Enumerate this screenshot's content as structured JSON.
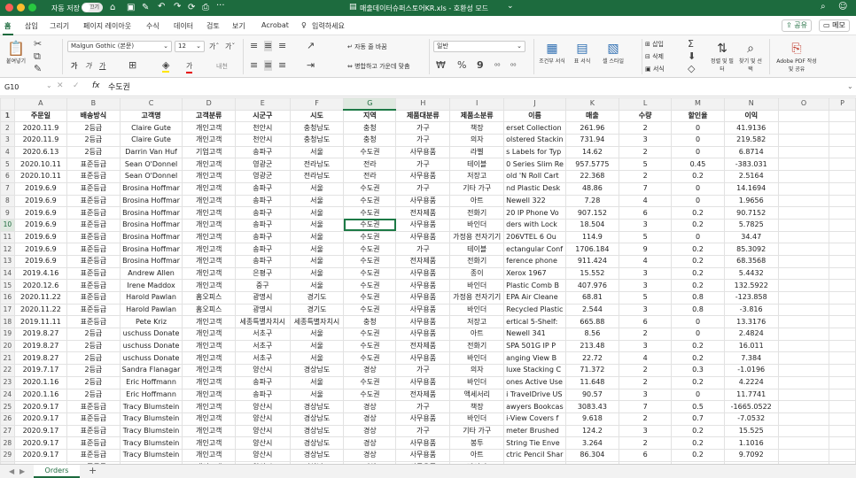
{
  "titlebar": {
    "autosave_label": "자동 저장",
    "autosave_toggle": "끄기",
    "file_title": "매출데이터슈퍼스토어KR.xls  -  호환성 모드",
    "chev": "⌄"
  },
  "tabs": [
    "홈",
    "삽입",
    "그리기",
    "페이지 레이아웃",
    "수식",
    "데이터",
    "검토",
    "보기",
    "Acrobat"
  ],
  "tell_me": "입력하세요",
  "share_label": "공유",
  "memo_label": "메모",
  "ribbon": {
    "paste": "붙여넣기",
    "font_name": "Malgun Gothic (본문)",
    "font_size": "12",
    "grow": "가ˆ",
    "shrink": "가ˇ",
    "bold": "가",
    "italic": "가",
    "underline": "가",
    "font_color_label": "가",
    "wrap": "자동 줄 바꿈",
    "merge": "병합하고 가운데 맞춤",
    "number_format": "일반",
    "percent": "%",
    "comma": "9",
    "cond_format": "조건부 서식",
    "table_format": "표 서식",
    "cell_style": "셀 스타일",
    "insert": "삽입",
    "delete": "삭제",
    "format": "서식",
    "sort_filter": "정렬 및 필터",
    "find_select": "찾기 및 선택",
    "adobe": "Adobe PDF 작성 및 공유"
  },
  "formula_bar": {
    "name_box": "G10",
    "fx": "fx",
    "value": "수도권"
  },
  "columns": [
    "A",
    "B",
    "C",
    "D",
    "E",
    "F",
    "G",
    "H",
    "I",
    "J",
    "K",
    "L",
    "M",
    "N",
    "O",
    "P"
  ],
  "rows": [
    [
      "주문일",
      "배송방식",
      "고객명",
      "고객분류",
      "시군구",
      "시도",
      "지역",
      "제품대분류",
      "제품소분류",
      "이름",
      "매출",
      "수량",
      "할인율",
      "이익",
      "",
      ""
    ],
    [
      "2020.11.9",
      "2등급",
      "Claire Gute",
      "개인고객",
      "천안시",
      "충청남도",
      "충청",
      "가구",
      "책장",
      "erset Collection",
      "261.96",
      "2",
      "0",
      "41.9136",
      "",
      ""
    ],
    [
      "2020.11.9",
      "2등급",
      "Claire Gute",
      "개인고객",
      "천안시",
      "충청남도",
      "충청",
      "가구",
      "의자",
      "olstered Stackin",
      "731.94",
      "3",
      "0",
      "219.582",
      "",
      ""
    ],
    [
      "2020.6.13",
      "2등급",
      "Darrin Van Huf",
      "기업고객",
      "송파구",
      "서울",
      "수도권",
      "사무용품",
      "라벨",
      "s Labels for Typ",
      "14.62",
      "2",
      "0",
      "6.8714",
      "",
      ""
    ],
    [
      "2020.10.11",
      "표준등급",
      "Sean O'Donnel",
      "개인고객",
      "영광군",
      "전라남도",
      "전라",
      "가구",
      "테이블",
      "0 Series Slim Re",
      "957.5775",
      "5",
      "0.45",
      "-383.031",
      "",
      ""
    ],
    [
      "2020.10.11",
      "표준등급",
      "Sean O'Donnel",
      "개인고객",
      "영광군",
      "전라남도",
      "전라",
      "사무용품",
      "저장고",
      "old 'N Roll Cart",
      "22.368",
      "2",
      "0.2",
      "2.5164",
      "",
      ""
    ],
    [
      "2019.6.9",
      "표준등급",
      "Brosina Hoffmar",
      "개인고객",
      "송파구",
      "서울",
      "수도권",
      "가구",
      "기타 가구",
      "nd Plastic Desk",
      "48.86",
      "7",
      "0",
      "14.1694",
      "",
      ""
    ],
    [
      "2019.6.9",
      "표준등급",
      "Brosina Hoffmar",
      "개인고객",
      "송파구",
      "서울",
      "수도권",
      "사무용품",
      "아트",
      "Newell 322",
      "7.28",
      "4",
      "0",
      "1.9656",
      "",
      ""
    ],
    [
      "2019.6.9",
      "표준등급",
      "Brosina Hoffmar",
      "개인고객",
      "송파구",
      "서울",
      "수도권",
      "전자제품",
      "전화기",
      "20 IP Phone Vo",
      "907.152",
      "6",
      "0.2",
      "90.7152",
      "",
      ""
    ],
    [
      "2019.6.9",
      "표준등급",
      "Brosina Hoffmar",
      "개인고객",
      "송파구",
      "서울",
      "수도권",
      "사무용품",
      "바인더",
      "ders with Lock",
      "18.504",
      "3",
      "0.2",
      "5.7825",
      "",
      ""
    ],
    [
      "2019.6.9",
      "표준등급",
      "Brosina Hoffmar",
      "개인고객",
      "송파구",
      "서울",
      "수도권",
      "사무용품",
      "가정용 전자기기",
      "206VTEL 6 Ou",
      "114.9",
      "5",
      "0",
      "34.47",
      "",
      ""
    ],
    [
      "2019.6.9",
      "표준등급",
      "Brosina Hoffmar",
      "개인고객",
      "송파구",
      "서울",
      "수도권",
      "가구",
      "테이블",
      "ectangular Conf",
      "1706.184",
      "9",
      "0.2",
      "85.3092",
      "",
      ""
    ],
    [
      "2019.6.9",
      "표준등급",
      "Brosina Hoffmar",
      "개인고객",
      "송파구",
      "서울",
      "수도권",
      "전자제품",
      "전화기",
      "ference phone",
      "911.424",
      "4",
      "0.2",
      "68.3568",
      "",
      ""
    ],
    [
      "2019.4.16",
      "표준등급",
      "Andrew Allen",
      "개인고객",
      "은평구",
      "서울",
      "수도권",
      "사무용품",
      "종이",
      "Xerox 1967",
      "15.552",
      "3",
      "0.2",
      "5.4432",
      "",
      ""
    ],
    [
      "2020.12.6",
      "표준등급",
      "Irene Maddox",
      "개인고객",
      "중구",
      "서울",
      "수도권",
      "사무용품",
      "바인더",
      "Plastic Comb B",
      "407.976",
      "3",
      "0.2",
      "132.5922",
      "",
      ""
    ],
    [
      "2020.11.22",
      "표준등급",
      "Harold Pawlan",
      "홈오피스",
      "광명시",
      "경기도",
      "수도권",
      "사무용품",
      "가정용 전자기기",
      "EPA Air Cleane",
      "68.81",
      "5",
      "0.8",
      "-123.858",
      "",
      ""
    ],
    [
      "2020.11.22",
      "표준등급",
      "Harold Pawlan",
      "홈오피스",
      "광명시",
      "경기도",
      "수도권",
      "사무용품",
      "바인더",
      "Recycled Plastic",
      "2.544",
      "3",
      "0.8",
      "-3.816",
      "",
      ""
    ],
    [
      "2019.11.11",
      "표준등급",
      "Pete Kriz",
      "개인고객",
      "세종특별자치시",
      "세종특별자치시",
      "충청",
      "사무용품",
      "저장고",
      "ertical 5-Shelf: ",
      "665.88",
      "6",
      "0",
      "13.3176",
      "",
      ""
    ],
    [
      "2019.8.27",
      "2등급",
      "uschuss Donate",
      "개인고객",
      "서초구",
      "서울",
      "수도권",
      "사무용품",
      "아트",
      "Newell 341",
      "8.56",
      "2",
      "0",
      "2.4824",
      "",
      ""
    ],
    [
      "2019.8.27",
      "2등급",
      "uschuss Donate",
      "개인고객",
      "서초구",
      "서울",
      "수도권",
      "전자제품",
      "전화기",
      "SPA 501G IP P",
      "213.48",
      "3",
      "0.2",
      "16.011",
      "",
      ""
    ],
    [
      "2019.8.27",
      "2등급",
      "uschuss Donate",
      "개인고객",
      "서초구",
      "서울",
      "수도권",
      "사무용품",
      "바인더",
      "anging View B",
      "22.72",
      "4",
      "0.2",
      "7.384",
      "",
      ""
    ],
    [
      "2019.7.17",
      "2등급",
      "Sandra Flanagar",
      "개인고객",
      "양산시",
      "경상남도",
      "경상",
      "가구",
      "의자",
      "luxe Stacking C",
      "71.372",
      "2",
      "0.3",
      "-1.0196",
      "",
      ""
    ],
    [
      "2020.1.16",
      "2등급",
      "Eric Hoffmann",
      "개인고객",
      "송파구",
      "서울",
      "수도권",
      "사무용품",
      "바인더",
      "ones Active Use",
      "11.648",
      "2",
      "0.2",
      "4.2224",
      "",
      ""
    ],
    [
      "2020.1.16",
      "2등급",
      "Eric Hoffmann",
      "개인고객",
      "송파구",
      "서울",
      "수도권",
      "전자제품",
      "액세서리",
      "i TravelDrive US",
      "90.57",
      "3",
      "0",
      "11.7741",
      "",
      ""
    ],
    [
      "2020.9.17",
      "표준등급",
      "Tracy Blumstein",
      "개인고객",
      "양산시",
      "경상남도",
      "경상",
      "가구",
      "책장",
      "awyers Bookcas",
      "3083.43",
      "7",
      "0.5",
      "-1665.0522",
      "",
      ""
    ],
    [
      "2020.9.17",
      "표준등급",
      "Tracy Blumstein",
      "개인고객",
      "양산시",
      "경상남도",
      "경상",
      "사무용품",
      "바인더",
      "i-View Covers f",
      "9.618",
      "2",
      "0.7",
      "-7.0532",
      "",
      ""
    ],
    [
      "2020.9.17",
      "표준등급",
      "Tracy Blumstein",
      "개인고객",
      "양산시",
      "경상남도",
      "경상",
      "가구",
      "기타 가구",
      "meter Brushed",
      "124.2",
      "3",
      "0.2",
      "15.525",
      "",
      ""
    ],
    [
      "2020.9.17",
      "표준등급",
      "Tracy Blumstein",
      "개인고객",
      "양산시",
      "경상남도",
      "경상",
      "사무용품",
      "봉투",
      "String Tie Enve",
      "3.264",
      "2",
      "0.2",
      "1.1016",
      "",
      ""
    ],
    [
      "2020.9.17",
      "표준등급",
      "Tracy Blumstein",
      "개인고객",
      "양산시",
      "경상남도",
      "경상",
      "사무용품",
      "아트",
      "ctric Pencil Shar",
      "86.304",
      "6",
      "0.2",
      "9.7092",
      "",
      ""
    ],
    [
      "2020.9.17",
      "표준등급",
      "Tracy Blumstein",
      "개인고객",
      "양산시",
      "경상남도",
      "경상",
      "사무용품",
      "바인더",
      "Storage Hooks",
      "6.858",
      "6",
      "0.7",
      "-5.715",
      "",
      ""
    ]
  ],
  "sheet_tabs": [
    "Orders"
  ],
  "add_sheet": "+"
}
